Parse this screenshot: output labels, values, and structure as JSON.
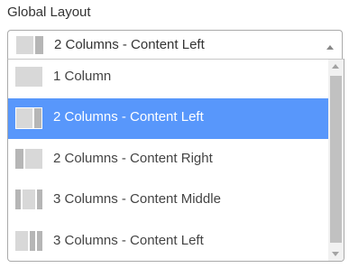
{
  "field": {
    "label": "Global Layout"
  },
  "select": {
    "value": "2 Columns - Content Left",
    "icon": "layout-2col-content-left-icon"
  },
  "options": [
    {
      "label": "1 Column",
      "icon": "layout-1col-icon",
      "selected": false
    },
    {
      "label": "2 Columns - Content Left",
      "icon": "layout-2col-content-left-icon",
      "selected": true
    },
    {
      "label": "2 Columns - Content Right",
      "icon": "layout-2col-content-right-icon",
      "selected": false
    },
    {
      "label": "3 Columns - Content Middle",
      "icon": "layout-3col-content-middle-icon",
      "selected": false
    },
    {
      "label": "3 Columns - Content Left",
      "icon": "layout-3col-content-left-icon",
      "selected": false
    }
  ],
  "colors": {
    "highlight": "#5897fb",
    "thumb_light": "#d8d8d8",
    "thumb_dark": "#b6b6b6"
  }
}
